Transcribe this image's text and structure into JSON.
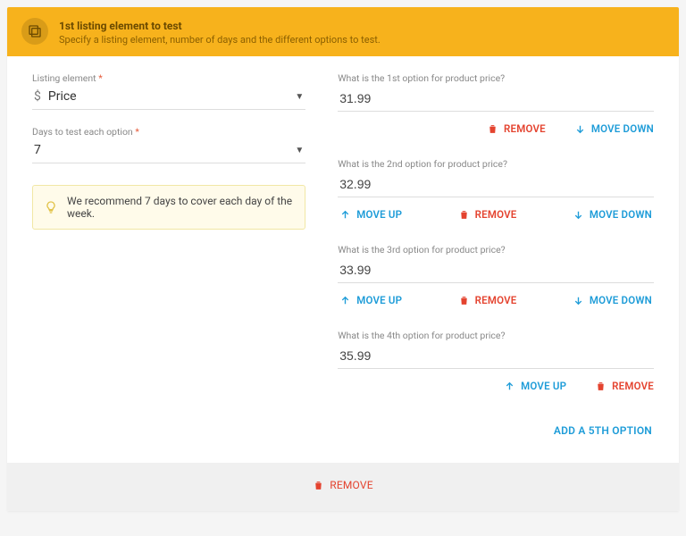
{
  "header": {
    "title": "1st listing element to test",
    "subtitle": "Specify a listing element, number of days and the different options to test."
  },
  "left": {
    "listing_label": "Listing element",
    "listing_value": "Price",
    "days_label": "Days to test each option",
    "days_value": "7",
    "tip": "We recommend 7 days to cover each day of the week."
  },
  "options": [
    {
      "label": "What is the 1st option for product price?",
      "value": "31.99",
      "move_up": false,
      "move_down": true
    },
    {
      "label": "What is the 2nd option for product price?",
      "value": "32.99",
      "move_up": true,
      "move_down": true
    },
    {
      "label": "What is the 3rd option for product price?",
      "value": "33.99",
      "move_up": true,
      "move_down": true
    },
    {
      "label": "What is the 4th option for product price?",
      "value": "35.99",
      "move_up": true,
      "move_down": false
    }
  ],
  "labels": {
    "move_up": "MOVE UP",
    "move_down": "MOVE DOWN",
    "remove": "REMOVE",
    "add_option": "ADD A 5TH OPTION"
  },
  "footer": {
    "remove": "REMOVE"
  }
}
